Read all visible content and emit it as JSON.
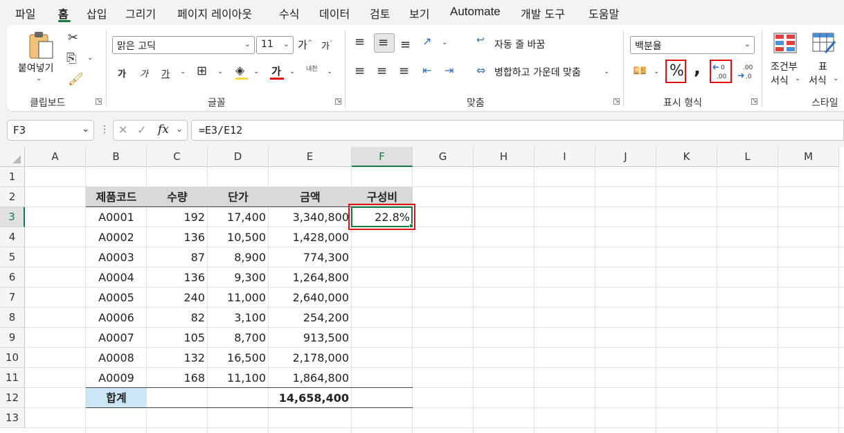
{
  "menu": {
    "items": [
      "파일",
      "홈",
      "삽입",
      "그리기",
      "페이지 레이아웃",
      "수식",
      "데이터",
      "검토",
      "보기",
      "Automate",
      "개발 도구",
      "도움말"
    ],
    "active": "홈"
  },
  "ribbon": {
    "clipboard": {
      "paste_label": "붙여넣기",
      "group_label": "클립보드"
    },
    "font": {
      "font_name": "맑은 고딕",
      "font_size": "11",
      "grow_label": "가",
      "shrink_label": "가",
      "bold_label": "가",
      "italic_label": "가",
      "underline_label": "가",
      "font_color_label": "가",
      "phonetic_label": "내천",
      "group_label": "글꼴"
    },
    "alignment": {
      "wrap_text_label": "자동 줄 바꿈",
      "merge_center_label": "병합하고 가운데 맞춤",
      "group_label": "맞춤"
    },
    "number": {
      "format_value": "백분율",
      "percent_label": "%",
      "comma_label": ",",
      "group_label": "표시 형식"
    },
    "styles": {
      "conditional_label_1": "조건부",
      "conditional_label_2": "서식",
      "table_label_1": "표",
      "table_label_2": "서식",
      "group_label": "스타일"
    }
  },
  "formula_bar": {
    "name_box": "F3",
    "fx_label": "fx",
    "formula": "=E3/E12"
  },
  "sheet": {
    "columns": [
      "A",
      "B",
      "C",
      "D",
      "E",
      "F",
      "G",
      "H",
      "I",
      "J",
      "K",
      "L",
      "M"
    ],
    "rows": [
      "1",
      "2",
      "3",
      "4",
      "5",
      "6",
      "7",
      "8",
      "9",
      "10",
      "11",
      "12",
      "13"
    ],
    "header": [
      "제품코드",
      "수량",
      "단가",
      "금액",
      "구성비"
    ],
    "data": [
      [
        "A0001",
        "192",
        "17,400",
        "3,340,800",
        "22.8%"
      ],
      [
        "A0002",
        "136",
        "10,500",
        "1,428,000",
        ""
      ],
      [
        "A0003",
        "87",
        "8,900",
        "774,300",
        ""
      ],
      [
        "A0004",
        "136",
        "9,300",
        "1,264,800",
        ""
      ],
      [
        "A0005",
        "240",
        "11,000",
        "2,640,000",
        ""
      ],
      [
        "A0006",
        "82",
        "3,100",
        "254,200",
        ""
      ],
      [
        "A0007",
        "105",
        "8,700",
        "913,500",
        ""
      ],
      [
        "A0008",
        "132",
        "16,500",
        "2,178,000",
        ""
      ],
      [
        "A0009",
        "168",
        "11,100",
        "1,864,800",
        ""
      ]
    ],
    "total_label": "합계",
    "total_amount": "14,658,400",
    "selected_cell": "F3"
  },
  "colors": {
    "accent": "#107c41",
    "header_fill": "#d9d9d9",
    "total_fill": "#cce6f6",
    "highlight": "#e01010"
  }
}
